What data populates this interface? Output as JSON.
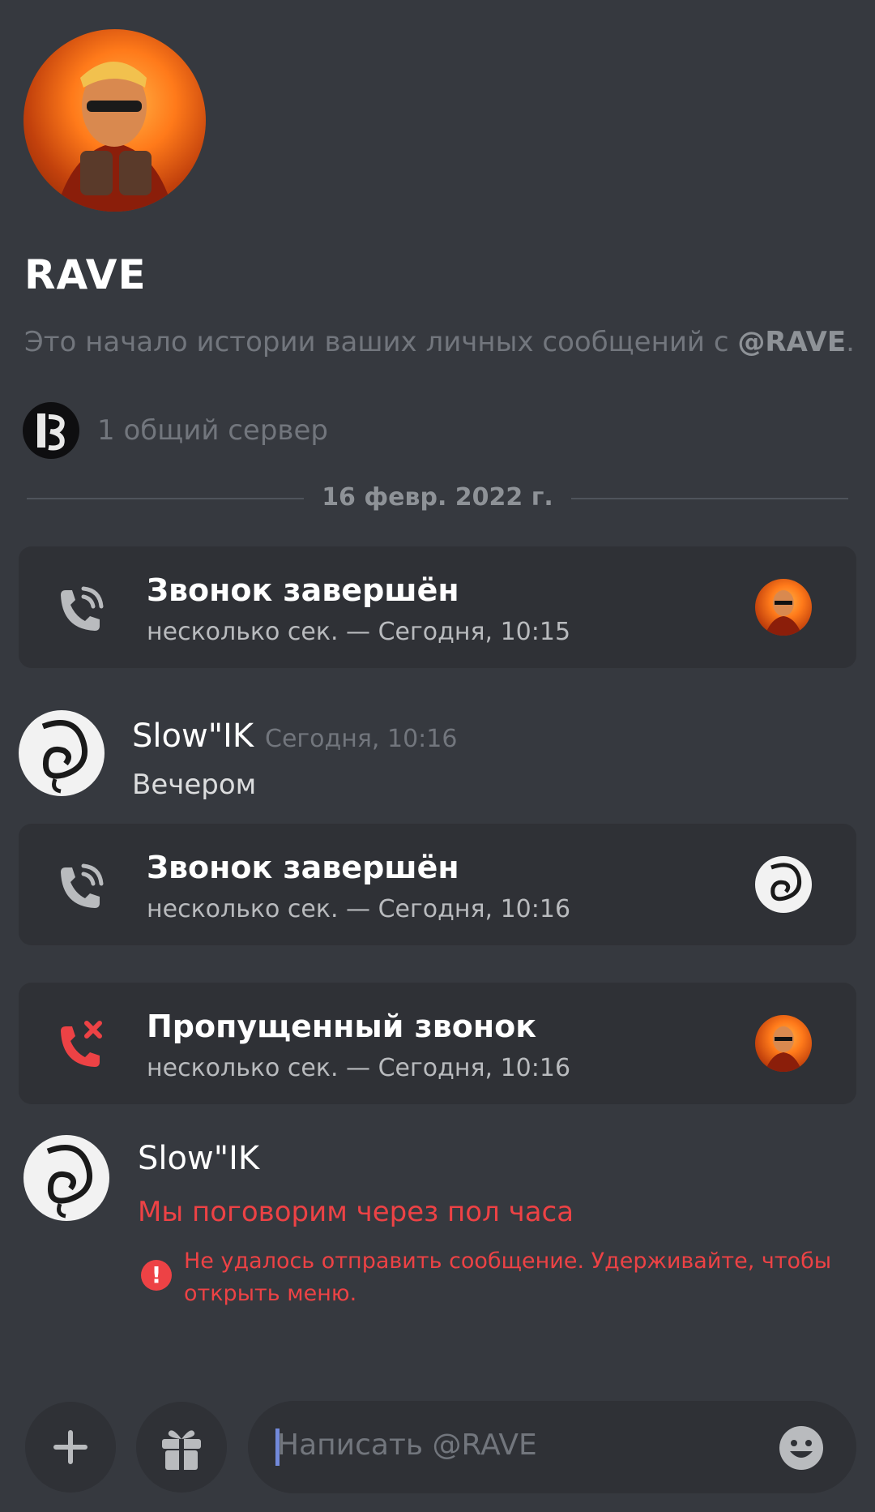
{
  "profile": {
    "name": "RAVE",
    "intro_text": "Это начало истории ваших личных сообщений с ",
    "intro_mention": "@RAVE",
    "intro_end": ".",
    "mutual_servers": "1 общий сервер"
  },
  "divider": {
    "date": "16 февр. 2022 г."
  },
  "calls": [
    {
      "title": "Звонок завершён",
      "subtitle": "несколько сек. — Сегодня, 10:15",
      "status": "ended",
      "avatar": "rave"
    },
    {
      "title": "Звонок завершён",
      "subtitle": "несколько сек. — Сегодня, 10:16",
      "status": "ended",
      "avatar": "slowik"
    },
    {
      "title": "Пропущенный звонок",
      "subtitle": "несколько сек. — Сегодня, 10:16",
      "status": "missed",
      "avatar": "rave"
    }
  ],
  "messages": [
    {
      "author": "Slow\"IK",
      "timestamp": "Сегодня, 10:16",
      "text": "Вечером"
    },
    {
      "author": "Slow\"IK",
      "text": "Мы поговорим через пол часа",
      "error": "Не удалось отправить сообщение. Удерживайте, чтобы открыть меню."
    }
  ],
  "composer": {
    "placeholder": "Написать @RAVE"
  },
  "icons": {
    "add": "plus-icon",
    "gift": "gift-icon",
    "emoji": "emoji-icon",
    "call_ended": "phone-ended-icon",
    "call_missed": "phone-missed-icon",
    "error": "exclamation-icon"
  },
  "colors": {
    "background": "#36393f",
    "card": "#2f3136",
    "error": "#ed4245",
    "muted_text": "#72767d",
    "accent": "#7289da"
  }
}
